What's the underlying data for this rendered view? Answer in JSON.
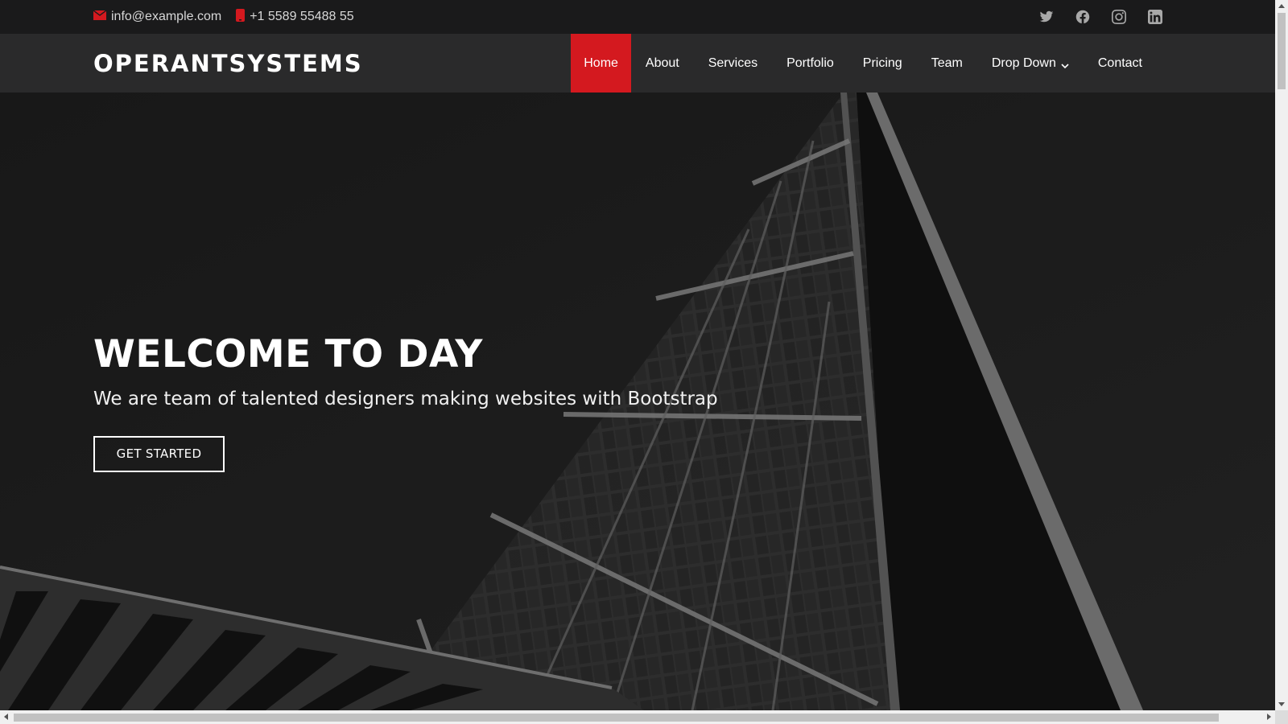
{
  "topbar": {
    "email": "info@example.com",
    "phone": "+1 5589 55488 55",
    "social": [
      "twitter-icon",
      "facebook-icon",
      "instagram-icon",
      "linkedin-icon"
    ]
  },
  "header": {
    "logo": "OPERANTSYSTEMS",
    "nav": [
      {
        "label": "Home",
        "active": true
      },
      {
        "label": "About"
      },
      {
        "label": "Services"
      },
      {
        "label": "Portfolio"
      },
      {
        "label": "Pricing"
      },
      {
        "label": "Team"
      },
      {
        "label": "Drop Down",
        "has_dropdown": true
      },
      {
        "label": "Contact"
      }
    ]
  },
  "hero": {
    "title": "WELCOME TO DAY",
    "subtitle": "We are team of talented designers making websites with Bootstrap",
    "cta": "GET STARTED"
  },
  "colors": {
    "accent": "#d4191f",
    "topbar_bg": "#1a1a1b",
    "header_bg": "#2a2a2b",
    "hero_bg": "#232323"
  }
}
